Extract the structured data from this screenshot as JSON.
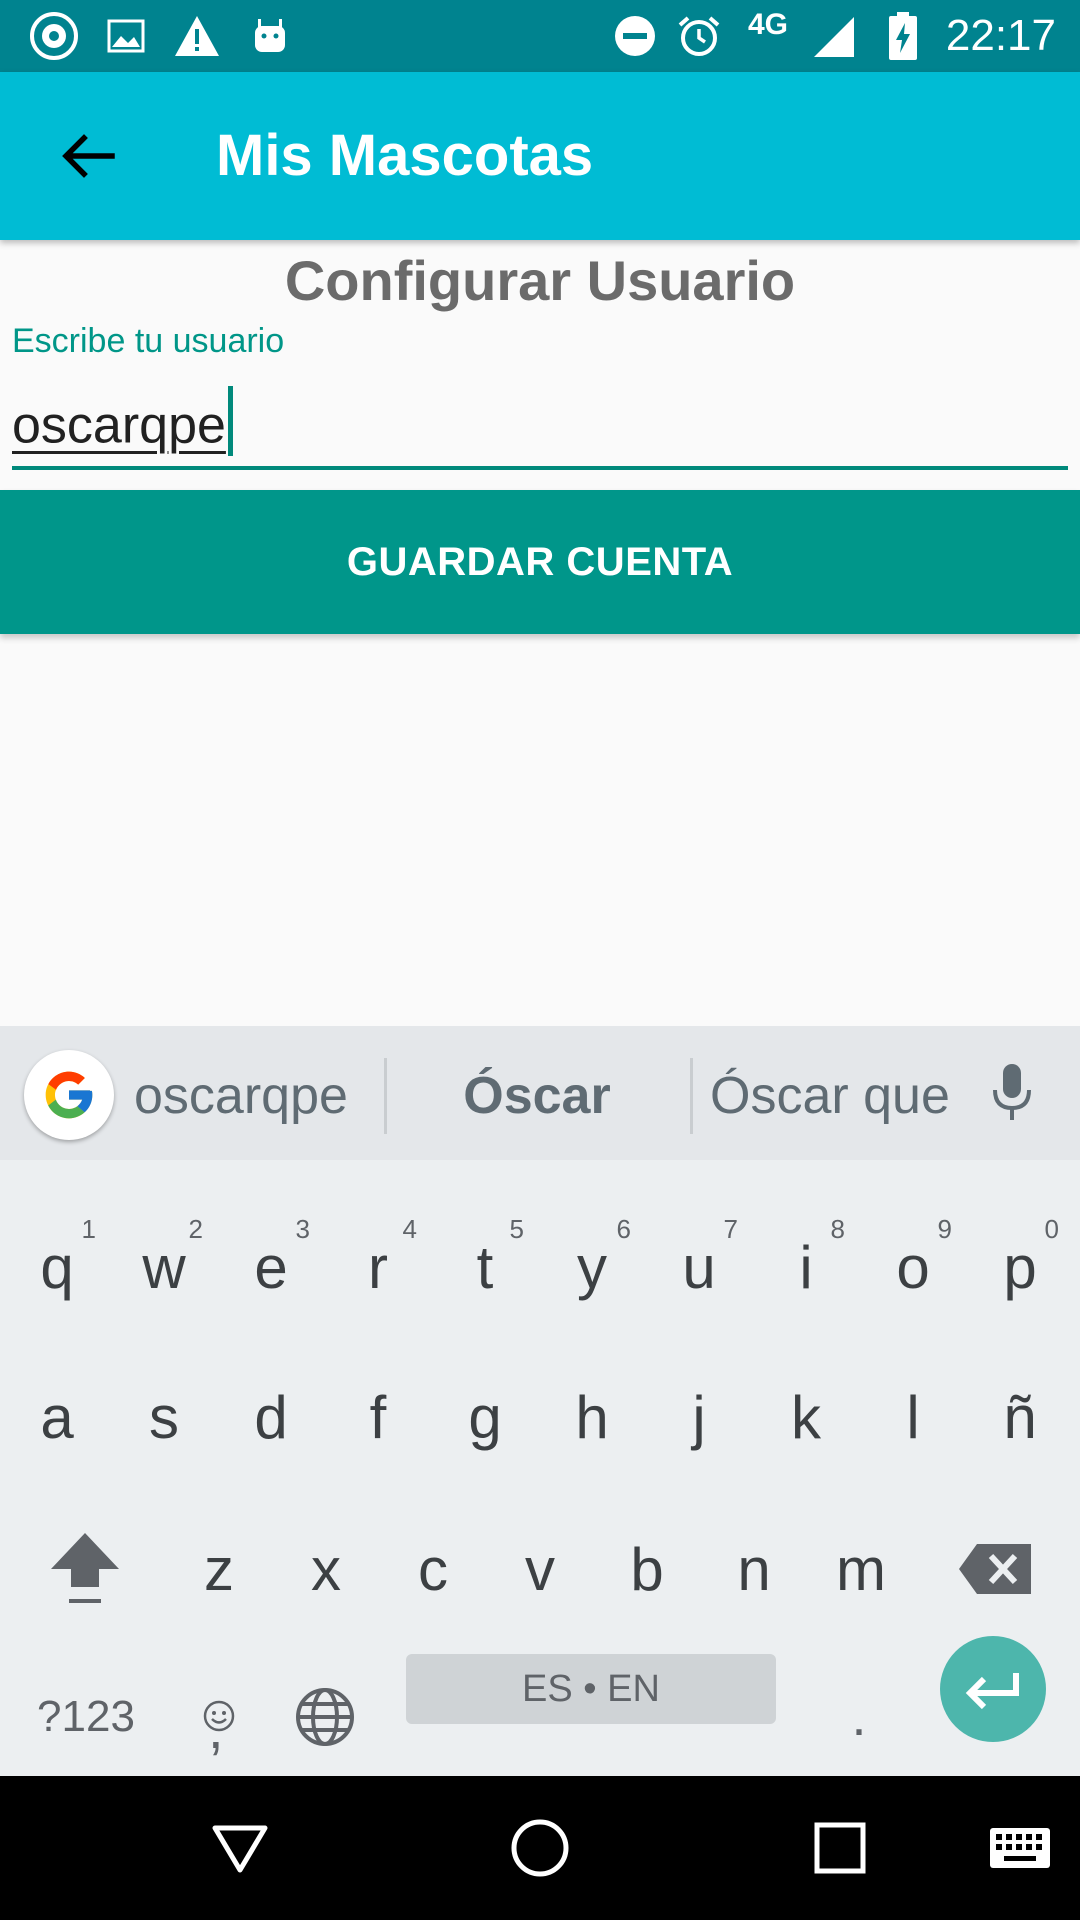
{
  "status_bar": {
    "time": "22:17",
    "network": "4G",
    "icons": [
      "app-notification-icon",
      "image-notification-icon",
      "warning-icon",
      "android-icon",
      "do-not-disturb-icon",
      "alarm-icon",
      "signal-icon",
      "battery-charging-icon"
    ]
  },
  "toolbar": {
    "title": "Mis Mascotas",
    "back_icon": "arrow-back-icon"
  },
  "form": {
    "title": "Configurar Usuario",
    "field_label": "Escribe tu usuario",
    "field_value": "oscarqpe",
    "save_label": "GUARDAR CUENTA"
  },
  "keyboard": {
    "suggestions": [
      "oscarqpe",
      "Óscar",
      "Óscar que"
    ],
    "row1": [
      {
        "k": "q",
        "s": "1"
      },
      {
        "k": "w",
        "s": "2"
      },
      {
        "k": "e",
        "s": "3"
      },
      {
        "k": "r",
        "s": "4"
      },
      {
        "k": "t",
        "s": "5"
      },
      {
        "k": "y",
        "s": "6"
      },
      {
        "k": "u",
        "s": "7"
      },
      {
        "k": "i",
        "s": "8"
      },
      {
        "k": "o",
        "s": "9"
      },
      {
        "k": "p",
        "s": "0"
      }
    ],
    "row2": [
      "a",
      "s",
      "d",
      "f",
      "g",
      "h",
      "j",
      "k",
      "l",
      "ñ"
    ],
    "row3": [
      "z",
      "x",
      "c",
      "v",
      "b",
      "n",
      "m"
    ],
    "symbols_label": "?123",
    "comma_label": ",",
    "space_label": "ES • EN",
    "period_label": ".",
    "accent_color": "#4db6ac"
  },
  "colors": {
    "status_bar": "#00838f",
    "toolbar": "#00bcd4",
    "accent": "#009688",
    "button": "#00968a"
  }
}
